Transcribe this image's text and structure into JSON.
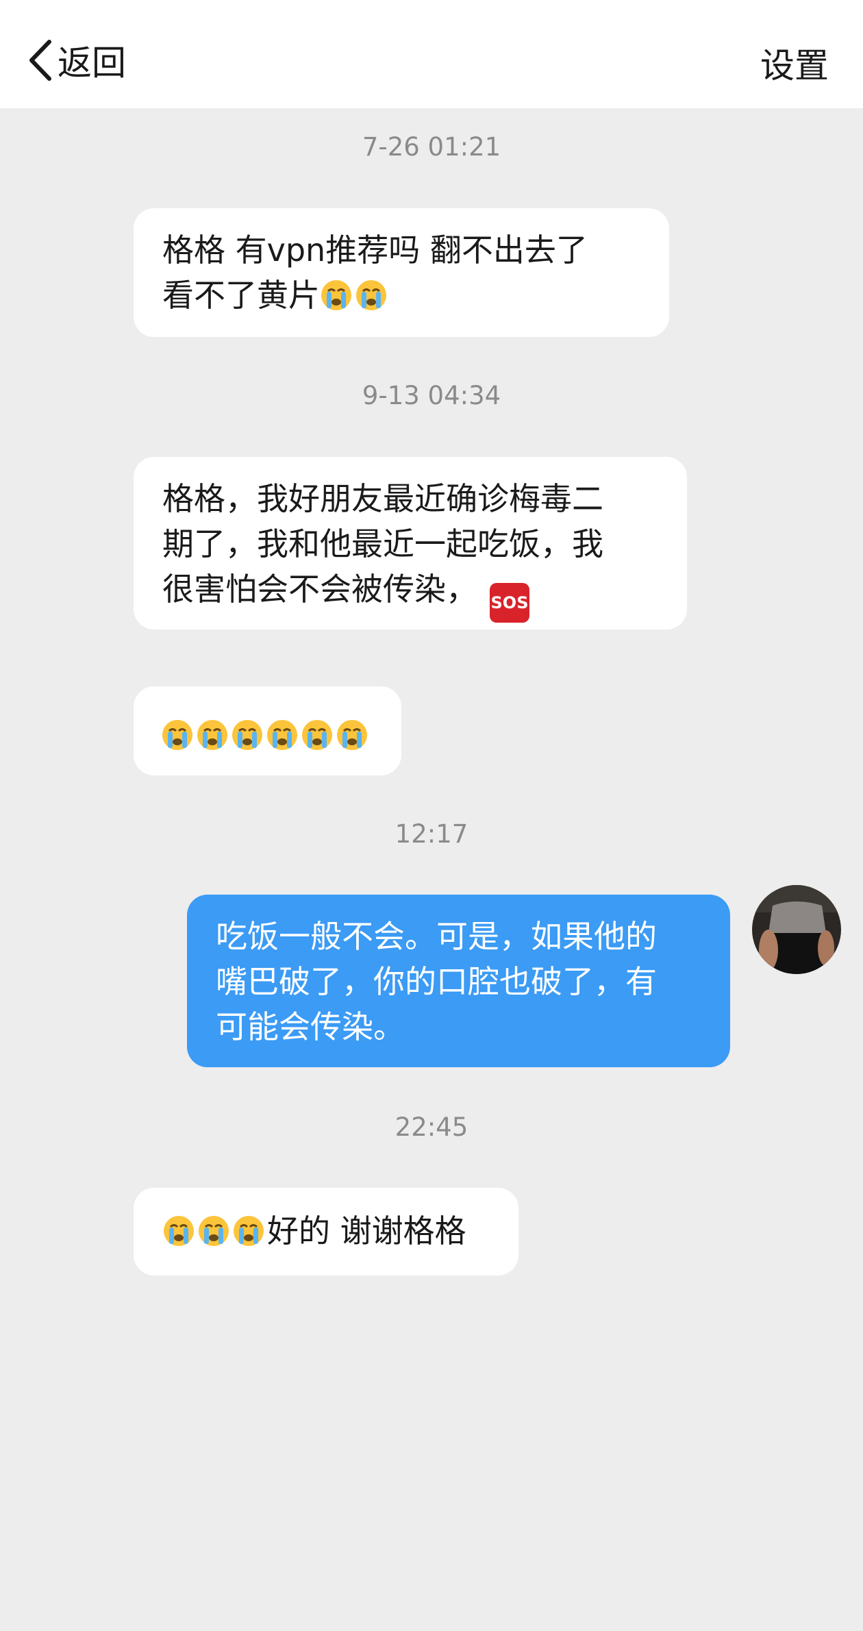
{
  "header": {
    "back_label": "返回",
    "settings_label": "设置"
  },
  "messages": [
    {
      "timestamp": "7-26 01:21",
      "text": "格格 有vpn推荐吗 翻不出去了",
      "text2": "看不了黄片",
      "trailing_emoji": [
        "crying-face",
        "crying-face"
      ]
    },
    {
      "timestamp": "9-13 04:34",
      "lines": [
        "格格，我好朋友最近确诊梅毒二",
        "期了，我和他最近一起吃饭，我",
        "很害怕会不会被传染，"
      ],
      "trailing_emoji": [
        "sos"
      ]
    },
    {
      "emoji_only": [
        "crying-face",
        "crying-face",
        "crying-face",
        "crying-face",
        "crying-face",
        "crying-face"
      ]
    },
    {
      "timestamp": "12:17",
      "sender": "self",
      "lines": [
        "吃饭一般不会。可是，如果他的",
        "嘴巴破了，你的口腔也破了，有",
        "可能会传染。"
      ]
    },
    {
      "timestamp": "22:45",
      "leading_emoji": [
        "crying-face",
        "crying-face",
        "crying-face"
      ],
      "text": "好的 谢谢格格"
    }
  ],
  "sos_label": "SOS",
  "colors": {
    "background": "#ededed",
    "incoming_bubble": "#ffffff",
    "outgoing_bubble": "#3b9bf5",
    "timestamp": "#8a8a8a"
  }
}
